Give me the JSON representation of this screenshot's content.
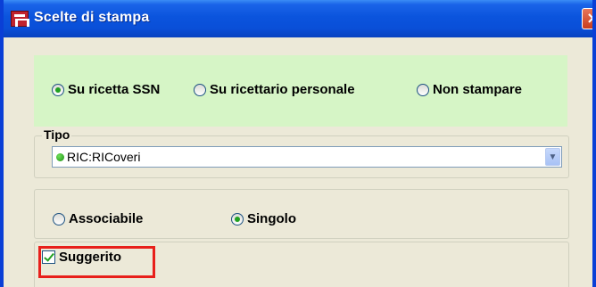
{
  "window": {
    "title": "Scelte di stampa",
    "close_glyph": "×"
  },
  "print_mode": {
    "options": [
      {
        "label": "Su ricetta SSN",
        "selected": true
      },
      {
        "label": "Su ricettario personale",
        "selected": false
      },
      {
        "label": "Non stampare",
        "selected": false
      }
    ]
  },
  "tipo": {
    "legend": "Tipo",
    "selected_value": "RIC:RICoveri",
    "status_color": "#21a121"
  },
  "grouping": {
    "options": [
      {
        "label": "Associabile",
        "selected": false
      },
      {
        "label": "Singolo",
        "selected": true
      }
    ]
  },
  "suggerito": {
    "label": "Suggerito",
    "checked": true,
    "highlight_color": "#e8201b"
  },
  "colors": {
    "titlebar": "#0a4fd8",
    "panel_background": "#ece9d8",
    "green_panel": "#d6f5c6"
  }
}
